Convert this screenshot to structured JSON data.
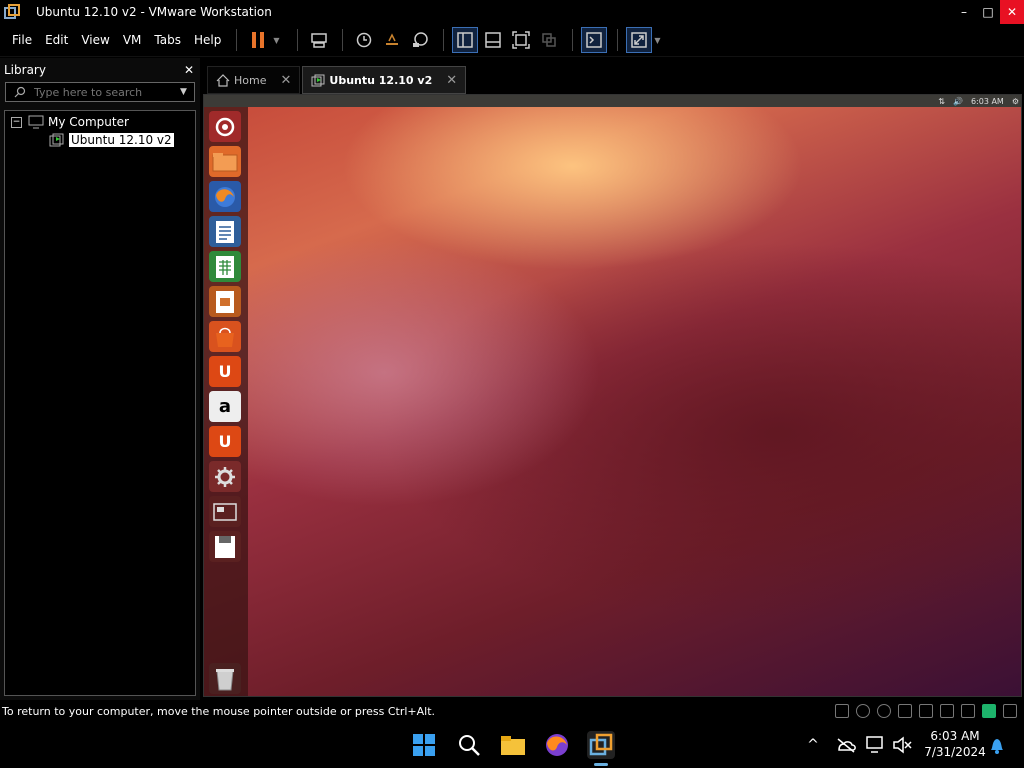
{
  "window": {
    "title": "Ubuntu 12.10 v2 - VMware Workstation",
    "minimize": "–",
    "maximize": "□",
    "close": "✕"
  },
  "menu": [
    "File",
    "Edit",
    "View",
    "VM",
    "Tabs",
    "Help"
  ],
  "library": {
    "title": "Library",
    "close": "✕",
    "search_placeholder": "Type here to search",
    "tree": {
      "root": "My Computer",
      "expander": "−",
      "child": "Ubuntu 12.10 v2"
    }
  },
  "tabs": [
    {
      "label": "Home",
      "close": "✕"
    },
    {
      "label": "Ubuntu 12.10 v2",
      "close": "✕"
    }
  ],
  "guest": {
    "panel_time": "6:03 AM",
    "launcher": [
      "dash-icon",
      "files-icon",
      "firefox-icon",
      "writer-icon",
      "calc-icon",
      "impress-icon",
      "software-center-icon",
      "ubuntu-one-icon",
      "amazon-icon",
      "ubuntu-one-music-icon",
      "settings-icon",
      "workspace-icon",
      "drive-icon",
      "trash-icon"
    ],
    "amazon_letter": "a",
    "u_letter": "U"
  },
  "statusbar": {
    "message": "To return to your computer, move the mouse pointer outside or press Ctrl+Alt."
  },
  "taskbar": {
    "time": "6:03 AM",
    "date": "7/31/2024",
    "overflow": "^"
  },
  "colors": {
    "accent": "#3b6fb5",
    "pause": "#e8742a",
    "close_red": "#e81123"
  }
}
